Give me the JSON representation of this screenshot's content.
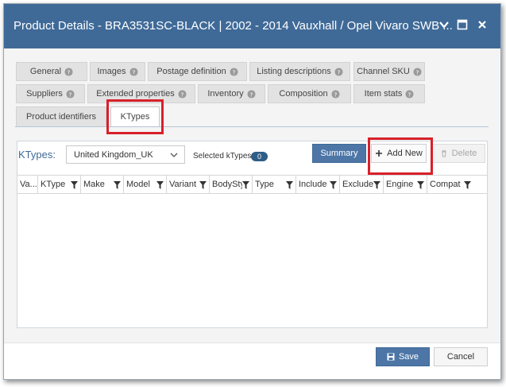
{
  "dialog": {
    "title": "Product Details - BRA3531SC-BLACK | 2002 - 2014 Vauxhall / Opel Vivaro SWB ...",
    "accent_color": "#3f6a98",
    "controls": [
      "chevron-down-icon",
      "maximize-icon",
      "close-icon"
    ]
  },
  "tabs": {
    "row1": [
      {
        "label": "General",
        "help": true
      },
      {
        "label": "Images",
        "help": true
      },
      {
        "label": "Postage definition",
        "help": true
      },
      {
        "label": "Listing descriptions",
        "help": true
      },
      {
        "label": "Channel SKU",
        "help": true
      }
    ],
    "row2": [
      {
        "label": "Suppliers",
        "help": true
      },
      {
        "label": "Extended properties",
        "help": true
      },
      {
        "label": "Inventory",
        "help": true
      },
      {
        "label": "Composition",
        "help": true
      },
      {
        "label": "Item stats",
        "help": true
      }
    ],
    "row3": [
      {
        "label": "Product identifiers",
        "help": false
      },
      {
        "label": "KTypes",
        "help": false,
        "active": true
      }
    ]
  },
  "ktypes": {
    "label": "KTypes:",
    "site_select": "United Kingdom_UK",
    "selected_label": "Selected kTypes:",
    "selected_count": "0",
    "summary_button": "Summary",
    "add_new_button": "Add New",
    "delete_button": "Delete"
  },
  "grid": {
    "columns": [
      "Va...",
      "KType",
      "Make",
      "Model",
      "Variant",
      "BodySty",
      "Type",
      "Include",
      "Exclude",
      "Engine",
      "Compat"
    ]
  },
  "footer": {
    "save_button": "Save",
    "cancel_button": "Cancel"
  },
  "highlight_color": "#d8202a"
}
